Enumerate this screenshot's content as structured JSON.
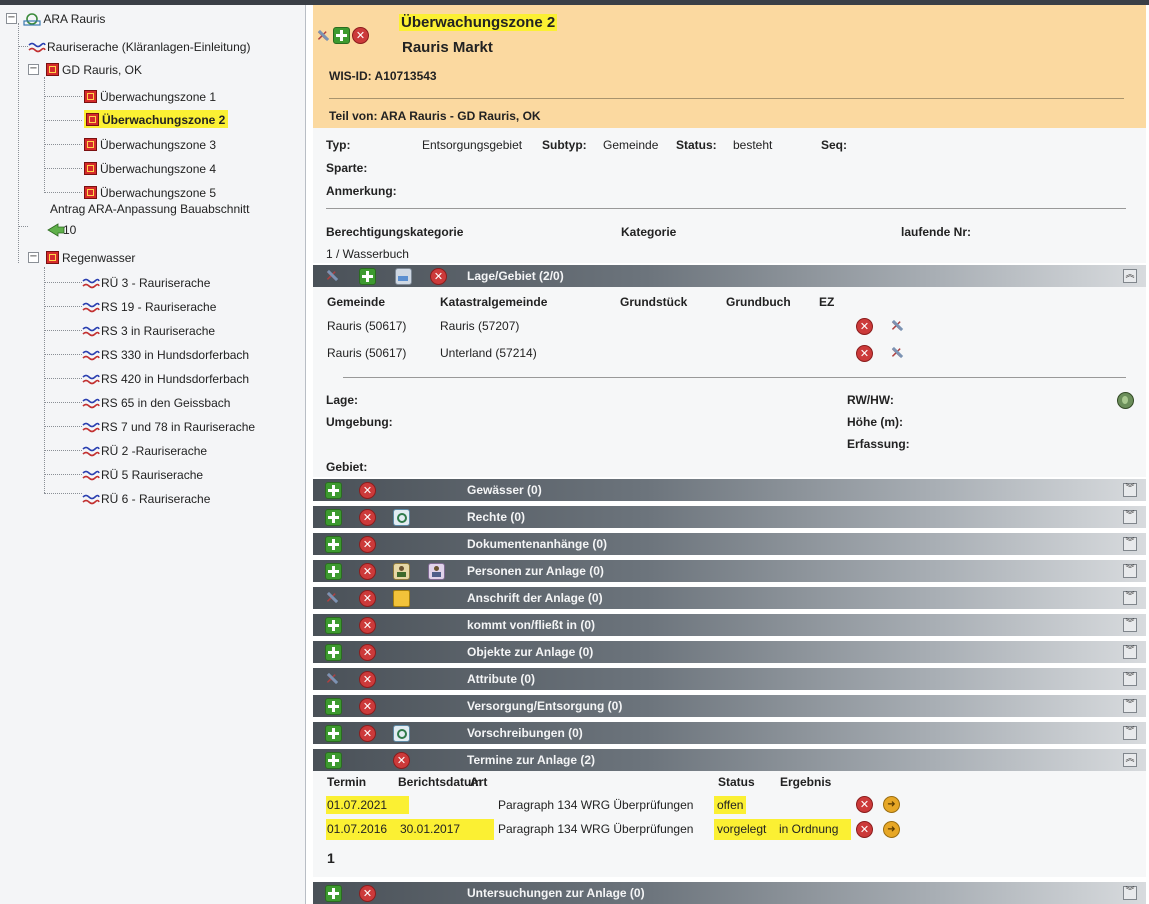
{
  "tree": {
    "root": {
      "label": "ARA Rauris"
    },
    "items": [
      {
        "label": "Rauriserache (Kläranlagen-Einleitung)"
      },
      {
        "label": "GD Rauris, OK"
      },
      {
        "label": "Überwachungszone 1"
      },
      {
        "label": "Überwachungszone 2"
      },
      {
        "label": "Überwachungszone 3"
      },
      {
        "label": "Überwachungszone 4"
      },
      {
        "label": "Überwachungszone 5"
      },
      {
        "label": "Antrag ARA-Anpassung Bauabschnitt"
      },
      {
        "label": "10"
      },
      {
        "label": "Regenwasser"
      },
      {
        "label": "RÜ 3 - Rauriserache"
      },
      {
        "label": "RS 19 - Rauriserache"
      },
      {
        "label": "RS 3 in Rauriserache"
      },
      {
        "label": "RS 330 in Hundsdorferbach"
      },
      {
        "label": "RS 420 in Hundsdorferbach"
      },
      {
        "label": "RS 65 in den Geissbach"
      },
      {
        "label": "RS 7 und 78 in Rauriserache"
      },
      {
        "label": "RÜ 2 -Rauriserache"
      },
      {
        "label": "RÜ 5 Rauriserache"
      },
      {
        "label": "RÜ 6 - Rauriserache"
      }
    ]
  },
  "header": {
    "title": "Überwachungszone 2",
    "subtitle": "Rauris Markt",
    "wis_id": "WIS-ID: A10713543",
    "teil_von": "Teil von: ARA Rauris - GD Rauris, OK"
  },
  "info": {
    "typ_label": "Typ:",
    "typ_value": "Entsorgungsgebiet",
    "subtyp_label": "Subtyp:",
    "subtyp_value": "Gemeinde",
    "status_label": "Status:",
    "status_value": "besteht",
    "seq_label": "Seq:",
    "sparte_label": "Sparte:",
    "anmerkung_label": "Anmerkung:",
    "berechtigung_label": "Berechtigungskategorie",
    "kategorie_label": "Kategorie",
    "laufende_label": "laufende Nr:",
    "berechtigung_value": "1 / Wasserbuch"
  },
  "lage": {
    "title": "Lage/Gebiet (2/0)",
    "columns": [
      "Gemeinde",
      "Katastralgemeinde",
      "Grundstück",
      "Grundbuch",
      "EZ"
    ],
    "rows": [
      {
        "gemeinde": "Rauris (50617)",
        "kg": "Rauris (57207)"
      },
      {
        "gemeinde": "Rauris (50617)",
        "kg": "Unterland (57214)"
      }
    ],
    "lage_label": "Lage:",
    "umgebung_label": "Umgebung:",
    "gebiet_label": "Gebiet:",
    "rwhw_label": "RW/HW:",
    "hoehe_label": "Höhe (m):",
    "erfassung_label": "Erfassung:"
  },
  "sections": [
    {
      "title": "Gewässer (0)"
    },
    {
      "title": "Rechte (0)"
    },
    {
      "title": "Dokumentenanhänge (0)"
    },
    {
      "title": "Personen zur Anlage (0)"
    },
    {
      "title": "Anschrift der Anlage (0)"
    },
    {
      "title": "kommt von/fließt in (0)"
    },
    {
      "title": "Objekte zur Anlage (0)"
    },
    {
      "title": "Attribute (0)"
    },
    {
      "title": "Versorgung/Entsorgung (0)"
    },
    {
      "title": "Vorschreibungen (0)"
    },
    {
      "title": "Termine zur Anlage (2)"
    },
    {
      "title": "Untersuchungen zur Anlage (0)"
    }
  ],
  "termine": {
    "columns": [
      "Termin",
      "Berichtsdatum",
      "Art",
      "Status",
      "Ergebnis"
    ],
    "rows": [
      {
        "termin": "01.07.2021",
        "bericht": "",
        "art": "Paragraph 134 WRG Überprüfungen",
        "status": "offen",
        "ergebnis": ""
      },
      {
        "termin": "01.07.2016",
        "bericht": "30.01.2017",
        "art": "Paragraph 134 WRG Überprüfungen",
        "status": "vorgelegt",
        "ergebnis": "in Ordnung"
      }
    ],
    "page": "1"
  },
  "colors": {
    "header_bg": "#fbd9a0",
    "highlight": "#fbf033",
    "bar_dark": "#4a5158"
  }
}
